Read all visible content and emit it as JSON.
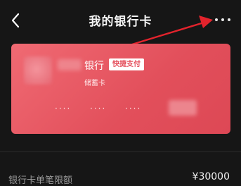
{
  "header": {
    "title": "我的银行卡",
    "back_icon": "chevron-left-icon",
    "more_icon": "more-horizontal-icon"
  },
  "card": {
    "bank_name": "银行",
    "quick_pay_badge": "快捷支付",
    "card_type": "储蓄卡",
    "masked_groups": [
      "····",
      "····",
      "····"
    ],
    "colors": {
      "card": "#e85661",
      "badge_text": "#e5505d"
    }
  },
  "limits": {
    "single_limit_label": "银行卡单笔限额",
    "single_limit_value": "¥30000"
  },
  "annotation": {
    "arrow_color": "#e3232c"
  }
}
